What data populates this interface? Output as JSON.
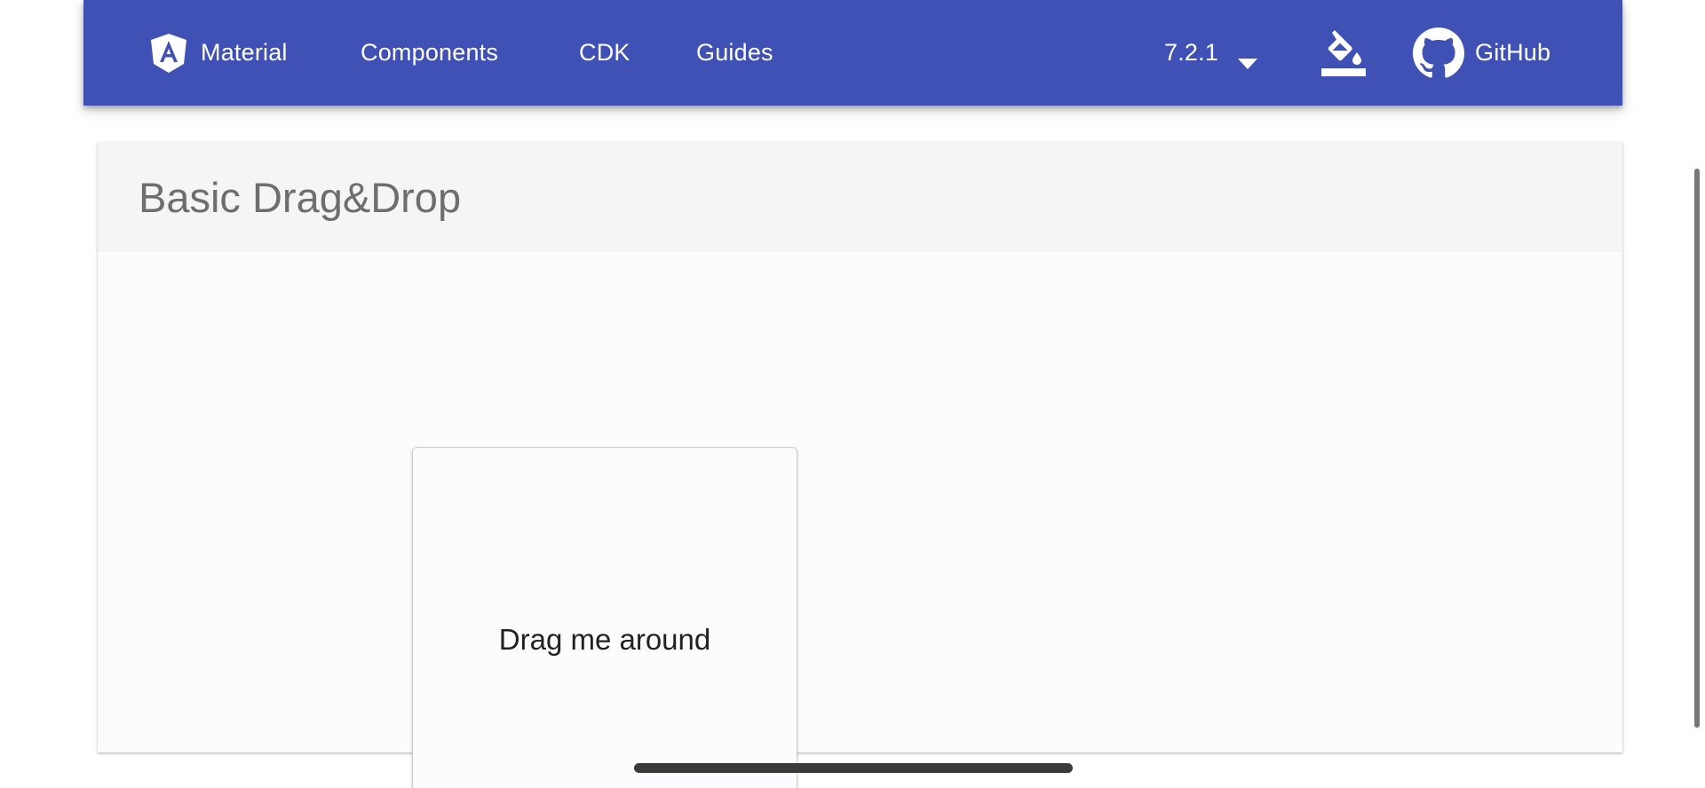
{
  "toolbar": {
    "brand_label": "Material",
    "nav_components": "Components",
    "nav_cdk": "CDK",
    "nav_guides": "Guides",
    "version": "7.2.1",
    "github_label": "GitHub",
    "background_color": "#3f51b5",
    "icons": {
      "logo": "angular-logo-icon",
      "version_caret": "caret-down-icon",
      "theme_picker": "format-color-fill-icon",
      "github": "github-icon"
    }
  },
  "example": {
    "title": "Basic Drag&Drop",
    "drag_box_label": "Drag me around"
  }
}
